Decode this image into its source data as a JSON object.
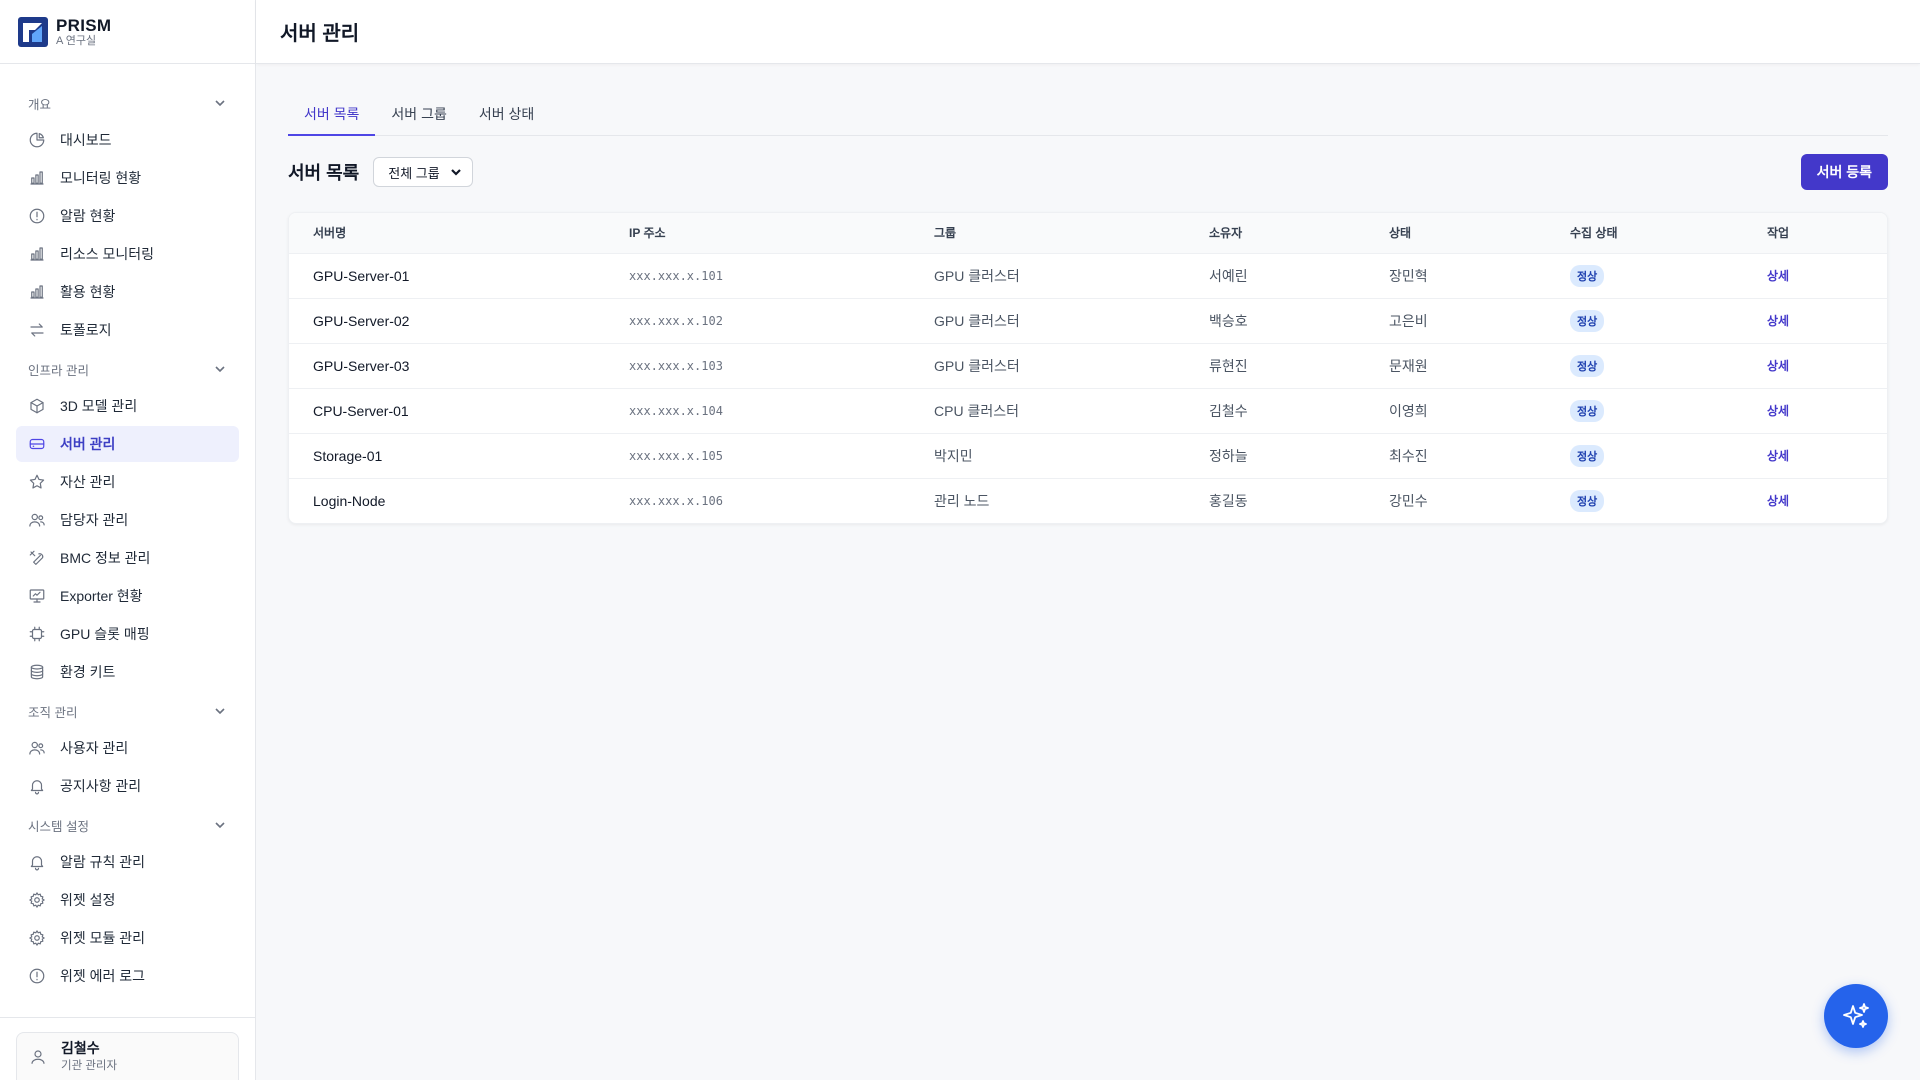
{
  "brand": {
    "name": "PRISM",
    "sub": "A 연구실"
  },
  "sidebar": {
    "sections": [
      {
        "title": "개요",
        "items": [
          {
            "label": "대시보드",
            "icon": "pie-chart-icon"
          },
          {
            "label": "모니터링 현황",
            "icon": "bar-chart-icon"
          },
          {
            "label": "알람 현황",
            "icon": "alert-circle-icon"
          },
          {
            "label": "리소스 모니터링",
            "icon": "bar-chart-icon"
          },
          {
            "label": "활용 현황",
            "icon": "bar-chart-icon"
          },
          {
            "label": "토폴로지",
            "icon": "arrows-swap-icon"
          }
        ]
      },
      {
        "title": "인프라 관리",
        "items": [
          {
            "label": "3D 모델 관리",
            "icon": "cube-icon"
          },
          {
            "label": "서버 관리",
            "icon": "server-icon",
            "active": true
          },
          {
            "label": "자산 관리",
            "icon": "star-icon"
          },
          {
            "label": "담당자 관리",
            "icon": "users-icon"
          },
          {
            "label": "BMC 정보 관리",
            "icon": "tools-icon"
          },
          {
            "label": "Exporter 현황",
            "icon": "presentation-icon"
          },
          {
            "label": "GPU 슬롯 매핑",
            "icon": "chip-icon"
          },
          {
            "label": "환경 키트",
            "icon": "database-icon"
          }
        ]
      },
      {
        "title": "조직 관리",
        "items": [
          {
            "label": "사용자 관리",
            "icon": "users-icon"
          },
          {
            "label": "공지사항 관리",
            "icon": "bell-icon"
          }
        ]
      },
      {
        "title": "시스템 설정",
        "items": [
          {
            "label": "알람 규칙 관리",
            "icon": "bell-icon"
          },
          {
            "label": "위젯 설정",
            "icon": "gear-icon"
          },
          {
            "label": "위젯 모듈 관리",
            "icon": "gear-icon"
          },
          {
            "label": "위젯 에러 로그",
            "icon": "alert-circle-icon"
          }
        ]
      }
    ]
  },
  "user": {
    "name": "김철수",
    "role": "기관 관리자"
  },
  "header": {
    "title": "서버 관리"
  },
  "tabs": [
    {
      "label": "서버 목록",
      "active": true
    },
    {
      "label": "서버 그룹"
    },
    {
      "label": "서버 상태"
    }
  ],
  "toolbar": {
    "title": "서버 목록",
    "group_filter": "전체 그룹",
    "register_label": "서버 등록"
  },
  "table": {
    "headers": [
      "서버명",
      "IP 주소",
      "그룹",
      "소유자",
      "상태",
      "수집 상태",
      "작업"
    ],
    "rows": [
      {
        "name": "GPU-Server-01",
        "ip": "xxx.xxx.x.101",
        "group": "GPU 클러스터",
        "owner": "서예린",
        "status": "장민혁",
        "collect": "정상",
        "action": "상세"
      },
      {
        "name": "GPU-Server-02",
        "ip": "xxx.xxx.x.102",
        "group": "GPU 클러스터",
        "owner": "백승호",
        "status": "고은비",
        "collect": "정상",
        "action": "상세"
      },
      {
        "name": "GPU-Server-03",
        "ip": "xxx.xxx.x.103",
        "group": "GPU 클러스터",
        "owner": "류현진",
        "status": "문재원",
        "collect": "정상",
        "action": "상세"
      },
      {
        "name": "CPU-Server-01",
        "ip": "xxx.xxx.x.104",
        "group": "CPU 클러스터",
        "owner": "김철수",
        "status": "이영희",
        "collect": "정상",
        "action": "상세"
      },
      {
        "name": "Storage-01",
        "ip": "xxx.xxx.x.105",
        "group": "박지민",
        "owner": "정하늘",
        "status": "최수진",
        "collect": "정상",
        "action": "상세"
      },
      {
        "name": "Login-Node",
        "ip": "xxx.xxx.x.106",
        "group": "관리 노드",
        "owner": "홍길동",
        "status": "강민수",
        "collect": "정상",
        "action": "상세"
      }
    ]
  },
  "fab": {
    "icon": "sparkles-icon"
  },
  "colors": {
    "accent": "#4338ca",
    "active_bg": "#eef0fd",
    "badge_bg": "#dbeafe",
    "fab": "#2563eb"
  }
}
